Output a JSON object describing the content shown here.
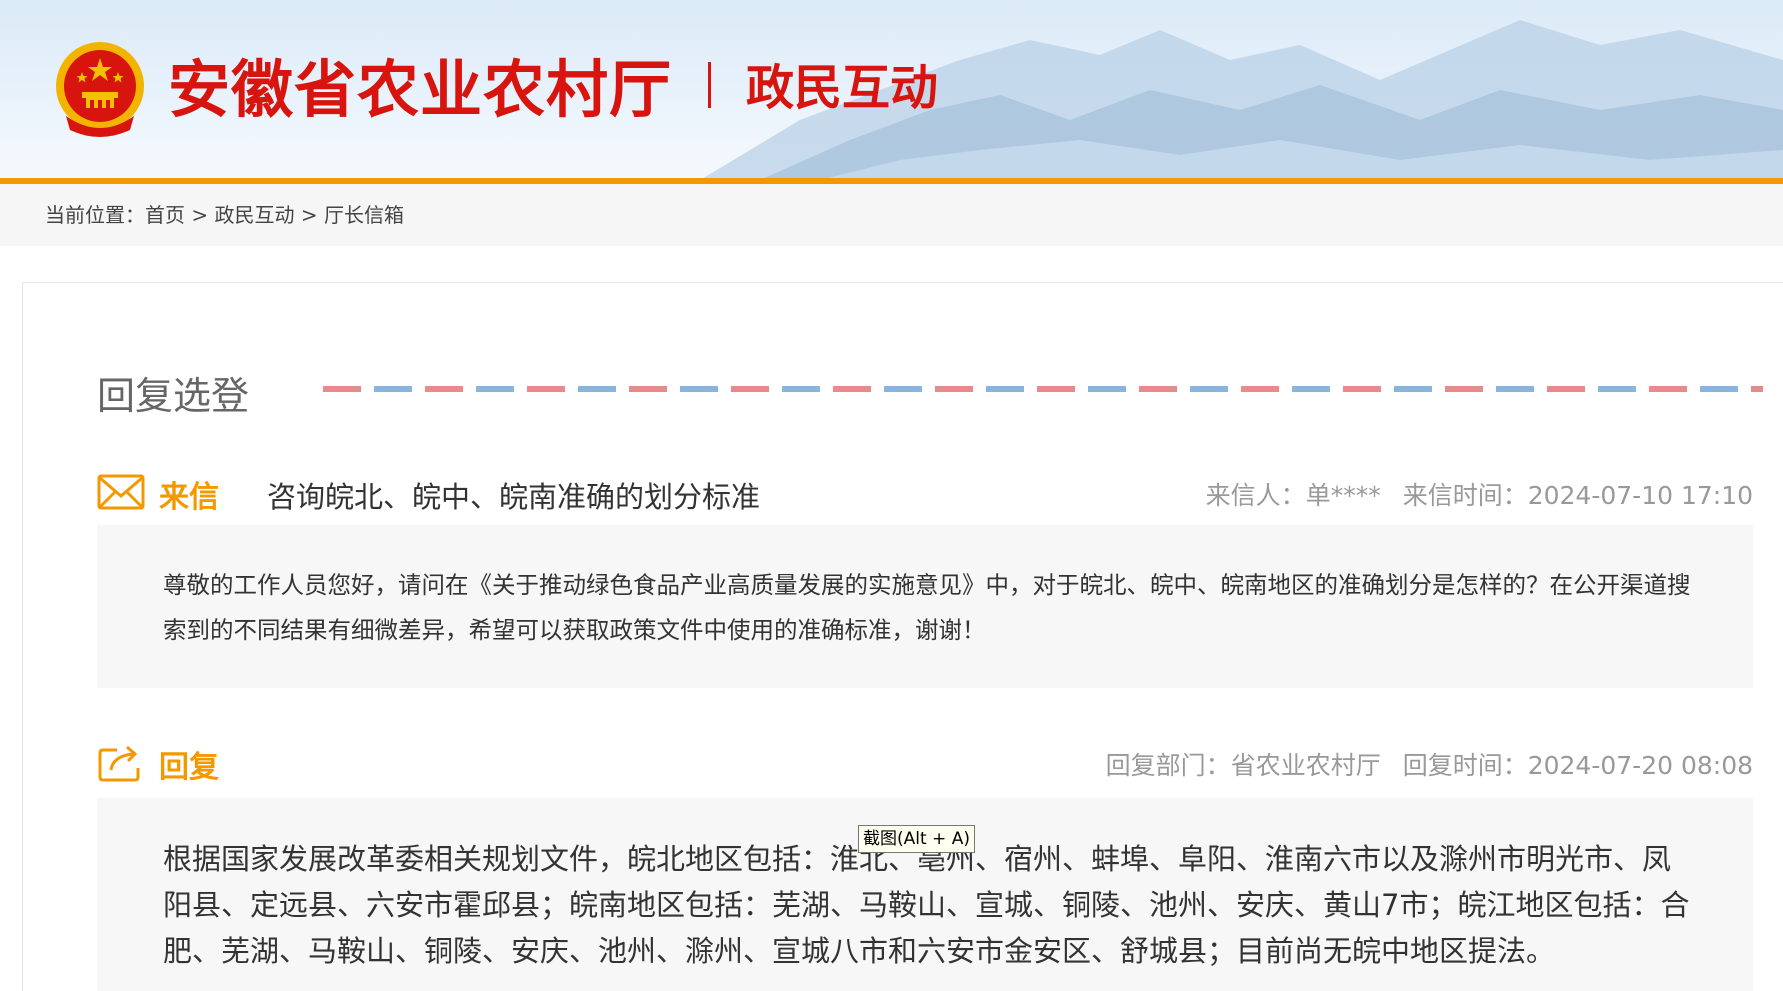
{
  "header": {
    "site_title": "安徽省农业农村厅",
    "section_title": "政民互动",
    "brand_color": "#d7140e",
    "accent_color": "#f39800",
    "emblem_icon": "national-emblem-icon"
  },
  "breadcrumb": {
    "prefix": "当前位置：",
    "items": [
      "首页",
      "政民互动",
      "厅长信箱"
    ],
    "separator": " > "
  },
  "panel": {
    "heading": "回复选登"
  },
  "letter": {
    "icon": "envelope-icon",
    "label": "来信",
    "subject": "咨询皖北、皖中、皖南准确的划分标准",
    "sender_label": "来信人：",
    "sender": "单****",
    "time_label": "来信时间：",
    "time": "2024-07-10 17:10",
    "body": "尊敬的工作人员您好，请问在《关于推动绿色食品产业高质量发展的实施意见》中，对于皖北、皖中、皖南地区的准确划分是怎样的？在公开渠道搜索到的不同结果有细微差异，希望可以获取政策文件中使用的准确标准，谢谢！"
  },
  "reply": {
    "icon": "share-reply-icon",
    "label": "回复",
    "dept_label": "回复部门：",
    "dept": "省农业农村厅",
    "time_label": "回复时间：",
    "time": "2024-07-20 08:08",
    "body": "根据国家发展改革委相关规划文件，皖北地区包括：淮北、亳州、宿州、蚌埠、阜阳、淮南六市以及滁州市明光市、凤阳县、定远县、六安市霍邱县；皖南地区包括：芜湖、马鞍山、宣城、铜陵、池州、安庆、黄山7市；皖江地区包括：合肥、芜湖、马鞍山、铜陵、安庆、池州、滁州、宣城八市和六安市金安区、舒城县；目前尚无皖中地区提法。"
  },
  "tooltip": {
    "text": "截图(Alt + A)"
  }
}
